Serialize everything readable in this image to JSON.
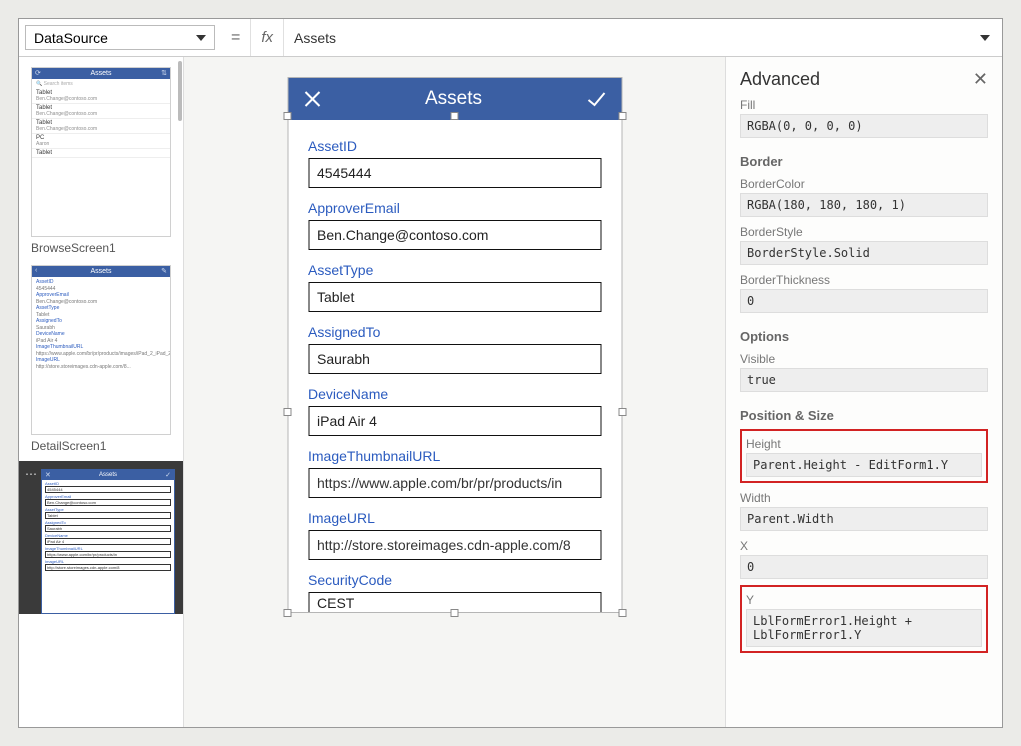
{
  "formula_bar": {
    "property": "DataSource",
    "equals": "=",
    "fx": "fx",
    "value": "Assets"
  },
  "thumbnails": {
    "browse": {
      "title": "Assets",
      "rows": [
        {
          "title": "Tablet",
          "sub": "Ben.Change@contoso.com"
        },
        {
          "title": "Tablet",
          "sub": "Ben.Change@contoso.com"
        },
        {
          "title": "Tablet",
          "sub": "Ben.Change@contoso.com"
        },
        {
          "title": "PC",
          "sub": "Aaron"
        },
        {
          "title": "Tablet",
          "sub": ""
        }
      ],
      "label": "BrowseScreen1"
    },
    "detail": {
      "title": "Assets",
      "lines": [
        "AssetID",
        "4545444",
        "ApproverEmail",
        "Ben.Change@contoso.com",
        "AssetType",
        "Tablet",
        "AssignedTo",
        "Saurabh",
        "DeviceName",
        "iPad Air 4",
        "ImageThumbnailURL"
      ],
      "label": "DetailScreen1"
    },
    "edit": {
      "title": "Assets",
      "fields": [
        {
          "label": "AssetID",
          "value": "4545444"
        },
        {
          "label": "ApproverEmail",
          "value": "Ben.Change@contoso.com"
        },
        {
          "label": "AssetType",
          "value": "Tablet"
        },
        {
          "label": "AssignedTo",
          "value": "Saurabh"
        },
        {
          "label": "DeviceName",
          "value": "iPad Air 4"
        },
        {
          "label": "ImageThumbnailURL",
          "value": "https://www.apple.com/br/pr/products/in"
        },
        {
          "label": "ImageURL",
          "value": "http://store.storeimages.cdn-apple.com/8"
        }
      ]
    }
  },
  "form": {
    "header_title": "Assets",
    "fields": [
      {
        "label": "AssetID",
        "value": "4545444"
      },
      {
        "label": "ApproverEmail",
        "value": "Ben.Change@contoso.com"
      },
      {
        "label": "AssetType",
        "value": "Tablet"
      },
      {
        "label": "AssignedTo",
        "value": "Saurabh"
      },
      {
        "label": "DeviceName",
        "value": "iPad Air 4"
      },
      {
        "label": "ImageThumbnailURL",
        "value": "https://www.apple.com/br/pr/products/in"
      },
      {
        "label": "ImageURL",
        "value": "http://store.storeimages.cdn-apple.com/8"
      },
      {
        "label": "SecurityCode",
        "value": "CEST"
      }
    ]
  },
  "advanced": {
    "title": "Advanced",
    "fill_label": "Fill",
    "fill_value": "RGBA(0, 0, 0, 0)",
    "border_section": "Border",
    "border_color_label": "BorderColor",
    "border_color_value": "RGBA(180, 180, 180, 1)",
    "border_style_label": "BorderStyle",
    "border_style_value": "BorderStyle.Solid",
    "border_thickness_label": "BorderThickness",
    "border_thickness_value": "0",
    "options_section": "Options",
    "visible_label": "Visible",
    "visible_value": "true",
    "position_section": "Position & Size",
    "height_label": "Height",
    "height_value": "Parent.Height - EditForm1.Y",
    "width_label": "Width",
    "width_value": "Parent.Width",
    "x_label": "X",
    "x_value": "0",
    "y_label": "Y",
    "y_value": "LblFormError1.Height + LblFormError1.Y"
  }
}
